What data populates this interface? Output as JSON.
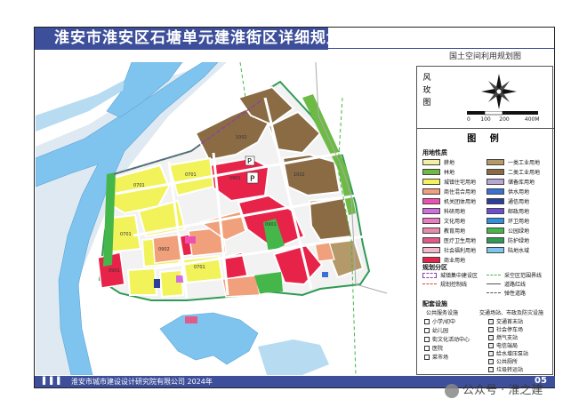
{
  "title": "淮安市淮安区石塘单元建淮街区详细规划",
  "subtitle": "国土空间利用规划图",
  "compass": {
    "label_chars": [
      "风",
      "玫",
      "图"
    ],
    "scale": [
      "0",
      "100",
      "200",
      "400M"
    ]
  },
  "legend": {
    "title": "图  例",
    "land_use_heading": "用地性质",
    "land_use_items": [
      {
        "code": "01",
        "label": "耕地",
        "color": "#f3f0a6"
      },
      {
        "code": "1001",
        "label": "一类工业用地",
        "color": "#b49a6a"
      },
      {
        "code": "03",
        "label": "林地",
        "color": "#6dbb45"
      },
      {
        "code": "1002",
        "label": "二类工业用地",
        "color": "#8a6b44"
      },
      {
        "code": "0701",
        "label": "城镇住宅用地",
        "color": "#f2f25a"
      },
      {
        "code": "1101",
        "label": "储备库用地",
        "color": "#b9a5d4"
      },
      {
        "code": "0902",
        "label": "商住混合用地",
        "color": "#f0a07a"
      },
      {
        "code": "1302",
        "label": "供水用地",
        "color": "#3a6fd6"
      },
      {
        "code": "0801",
        "label": "机关团体用地",
        "color": "#ef4fb0"
      },
      {
        "code": "1307",
        "label": "通信用地",
        "color": "#2d3d9a"
      },
      {
        "code": "0802",
        "label": "科研用地",
        "color": "#d070e0"
      },
      {
        "code": "1308",
        "label": "邮政用地",
        "color": "#6a4fd0"
      },
      {
        "code": "0803",
        "label": "文化用地",
        "color": "#f07ac0"
      },
      {
        "code": "1309",
        "label": "环卫用地",
        "color": "#2f8fe0"
      },
      {
        "code": "0804",
        "label": "教育用地",
        "color": "#e88aa8"
      },
      {
        "code": "1401",
        "label": "公园绿地",
        "color": "#45b64a"
      },
      {
        "code": "0806",
        "label": "医疗卫生用地",
        "color": "#e05a8a"
      },
      {
        "code": "1402",
        "label": "防护绿地",
        "color": "#2f9a55"
      },
      {
        "code": "0807",
        "label": "社会福利用地",
        "color": "#f4b8cc"
      },
      {
        "code": "17",
        "label": "陆地水域",
        "color": "#7fc4ee"
      },
      {
        "code": "0901",
        "label": "商业用地",
        "color": "#e8234a"
      }
    ],
    "zoning_heading": "规划分区",
    "zoning_items": [
      "城镇集中建设区",
      "采空区范围界线",
      "规划控制线",
      "道路红线",
      "弹性道路"
    ],
    "facilities_heading": "配套设施",
    "facility_col_headers": [
      "公共服务设施",
      "交通场站、市政及防灾设施"
    ],
    "facilities_left": [
      "小学/初中",
      "幼儿园",
      "街文化活动中心",
      "医院",
      "菜市场"
    ],
    "facilities_right": [
      "交通首末站",
      "社会停车场",
      "燃气支站",
      "电信端局",
      "给水增压泵站",
      "公共厕所",
      "垃圾转运站"
    ]
  },
  "map": {
    "parcel_labels": [
      "0701",
      "0902",
      "1002",
      "0901",
      "1401",
      "0804",
      "0806",
      "03"
    ],
    "parking_marker": "P"
  },
  "footer": {
    "org": "淮安市城市建设设计研究院有限公司   2024年",
    "page": "05",
    "marks": "▌▌▌"
  },
  "watermark": "公众号 · 淮之建",
  "colors": {
    "primary": "#3d4f9a",
    "water": "#7fc4ee",
    "road": "#ffffff",
    "river_bank": "#dfe9f2"
  }
}
